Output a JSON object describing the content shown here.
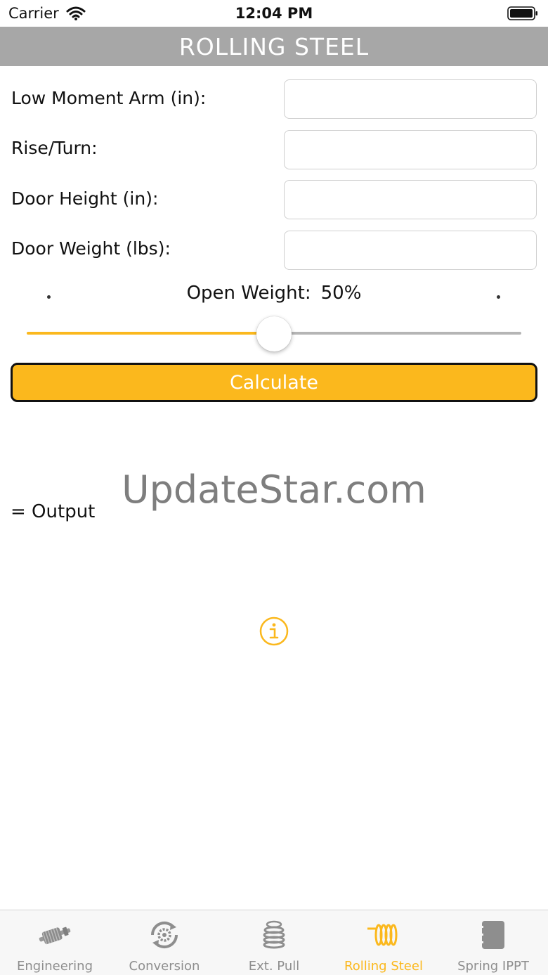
{
  "status_bar": {
    "carrier": "Carrier",
    "time": "12:04 PM"
  },
  "nav": {
    "title": "ROLLING STEEL"
  },
  "form": {
    "fields": [
      {
        "label": "Low Moment Arm (in):",
        "value": ""
      },
      {
        "label": "Rise/Turn:",
        "value": ""
      },
      {
        "label": "Door Height (in):",
        "value": ""
      },
      {
        "label": "Door Weight (lbs):",
        "value": ""
      }
    ],
    "open_weight_label": "Open Weight:",
    "open_weight_value": "50%",
    "slider_fraction": 0.5,
    "calculate_label": "Calculate"
  },
  "watermark": "UpdateStar.com",
  "output_label": "= Output",
  "tabs": [
    {
      "label": "Engineering",
      "icon": "spring-shaft-icon",
      "active": false
    },
    {
      "label": "Conversion",
      "icon": "gear-cycle-icon",
      "active": false
    },
    {
      "label": "Ext. Pull",
      "icon": "coil-stack-icon",
      "active": false
    },
    {
      "label": "Rolling Steel",
      "icon": "torsion-spring-icon",
      "active": true
    },
    {
      "label": "Spring IPPT",
      "icon": "notebook-icon",
      "active": false
    }
  ],
  "colors": {
    "accent": "#fbb81d",
    "nav_bg": "#a7a7a7",
    "inactive": "#8e8e8e"
  }
}
